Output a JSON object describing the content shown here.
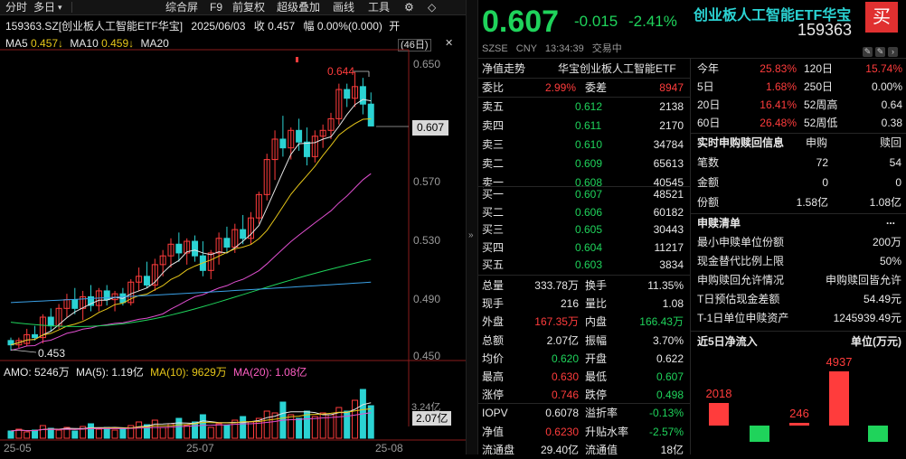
{
  "toolbar": {
    "items": [
      "分时",
      "多日",
      "▾",
      "综合屏",
      "F9",
      "前复权",
      "超级叠加",
      "画线",
      "工具",
      "⚙",
      "◇"
    ]
  },
  "chart_header": {
    "title": "159363.SZ[创业板人工智能ETF华宝]",
    "date": "2025/06/03",
    "close_label": "收 0.457",
    "change_label": "幅 0.00%(0.000)",
    "tail": "开"
  },
  "ma_line": {
    "ma5_label": "MA5",
    "ma5_value": "0.457↓",
    "ma10_label": "MA10",
    "ma10_value": "0.459↓",
    "ma20_label": "MA20",
    "days_badge": "(46日)"
  },
  "price_axis": {
    "ticks": [
      "0.650",
      "0.610",
      "0.570",
      "0.530",
      "0.490",
      "0.450"
    ],
    "current": "0.607",
    "high_label": "0.644",
    "low_label": "0.453"
  },
  "volume_header": {
    "amo": "AMO: 5246万",
    "ma5": "MA(5): 1.19亿",
    "ma10": "MA(10): 9629万",
    "ma20": "MA(20): 1.08亿"
  },
  "volume_axis": {
    "tick": "3.24亿",
    "current": "2.07亿"
  },
  "date_axis": [
    "25-05",
    "25-07",
    "25-08"
  ],
  "colors": {
    "up": "#ff3c3c",
    "down": "#1fd35b",
    "ma5": "#e6e6e6",
    "ma10": "#e6c619",
    "ma20": "#e04fd0",
    "ma60": "#1fd35b",
    "ma120": "#3aa0e6",
    "current": "#2bd3d3"
  },
  "quote": {
    "price": "0.607",
    "change": "-0.015",
    "pct": "-2.41%",
    "name": "创业板人工智能ETF华宝",
    "code": "159363",
    "buy_button": "买",
    "exchange": "SZSE",
    "currency": "CNY",
    "time": "13:34:39",
    "status": "交易中"
  },
  "order_book": {
    "header_left": "净值走势",
    "header_right": "华宝创业板人工智能ETF",
    "ratio_label": "委比",
    "ratio": "2.99%",
    "diff_label": "委差",
    "diff": "8947",
    "asks": [
      {
        "label": "卖五",
        "price": "0.612",
        "vol": "2138"
      },
      {
        "label": "卖四",
        "price": "0.611",
        "vol": "2170"
      },
      {
        "label": "卖三",
        "price": "0.610",
        "vol": "34784"
      },
      {
        "label": "卖二",
        "price": "0.609",
        "vol": "65613"
      },
      {
        "label": "卖一",
        "price": "0.608",
        "vol": "40545"
      }
    ],
    "bids": [
      {
        "label": "买一",
        "price": "0.607",
        "vol": "48521"
      },
      {
        "label": "买二",
        "price": "0.606",
        "vol": "60182"
      },
      {
        "label": "买三",
        "price": "0.605",
        "vol": "30443"
      },
      {
        "label": "买四",
        "price": "0.604",
        "vol": "11217"
      },
      {
        "label": "买五",
        "price": "0.603",
        "vol": "3834"
      }
    ]
  },
  "stats": [
    {
      "l1": "总量",
      "v1": "333.78万",
      "l2": "换手",
      "v2": "11.35%",
      "c1": "white",
      "c2": "white"
    },
    {
      "l1": "现手",
      "v1": "216",
      "l2": "量比",
      "v2": "1.08",
      "c1": "white",
      "c2": "white"
    },
    {
      "l1": "外盘",
      "v1": "167.35万",
      "l2": "内盘",
      "v2": "166.43万",
      "c1": "red",
      "c2": "green"
    },
    {
      "l1": "总额",
      "v1": "2.07亿",
      "l2": "振幅",
      "v2": "3.70%",
      "c1": "white",
      "c2": "white"
    },
    {
      "l1": "均价",
      "v1": "0.620",
      "l2": "开盘",
      "v2": "0.622",
      "c1": "green",
      "c2": "white"
    },
    {
      "l1": "最高",
      "v1": "0.630",
      "l2": "最低",
      "v2": "0.607",
      "c1": "red",
      "c2": "green"
    },
    {
      "l1": "涨停",
      "v1": "0.746",
      "l2": "跌停",
      "v2": "0.498",
      "c1": "red",
      "c2": "green"
    },
    {
      "l1": "IOPV",
      "v1": "0.6078",
      "l2": "溢折率",
      "v2": "-0.13%",
      "c1": "white",
      "c2": "green"
    },
    {
      "l1": "净值",
      "v1": "0.6230",
      "l2": "升贴水率",
      "v2": "-2.57%",
      "c1": "red",
      "c2": "green"
    },
    {
      "l1": "流通盘",
      "v1": "29.40亿",
      "l2": "流通值",
      "v2": "18亿",
      "c1": "white",
      "c2": "white"
    }
  ],
  "performance": [
    {
      "l1": "今年",
      "v1": "25.83%",
      "l2": "120日",
      "v2": "15.74%",
      "c1": "red",
      "c2": "red"
    },
    {
      "l1": "5日",
      "v1": "1.68%",
      "l2": "250日",
      "v2": "0.00%",
      "c1": "red",
      "c2": "white"
    },
    {
      "l1": "20日",
      "v1": "16.41%",
      "l2": "52周高",
      "v2": "0.64",
      "c1": "red",
      "c2": "white"
    },
    {
      "l1": "60日",
      "v1": "26.48%",
      "l2": "52周低",
      "v2": "0.38",
      "c1": "red",
      "c2": "white"
    }
  ],
  "subscribe": {
    "title": "实时申购赎回信息",
    "col1": "申购",
    "col2": "赎回",
    "rows": [
      {
        "label": "笔数",
        "v1": "72",
        "v2": "54"
      },
      {
        "label": "金额",
        "v1": "0",
        "v2": "0"
      },
      {
        "label": "份额",
        "v1": "1.58亿",
        "v2": "1.08亿"
      }
    ]
  },
  "list": {
    "title": "申赎清单",
    "more": "...",
    "rows": [
      {
        "label": "最小申赎单位份额",
        "value": "200万"
      },
      {
        "label": "现金替代比例上限",
        "value": "50%"
      },
      {
        "label": "申购赎回允许情况",
        "value": "申购赎回皆允许"
      },
      {
        "label": "T日预估现金差额",
        "value": "54.49元"
      },
      {
        "label": "T-1日单位申赎资产",
        "value": "1245939.49元"
      }
    ]
  },
  "netflow": {
    "title": "近5日净流入",
    "unit": "单位(万元)",
    "chart_data": {
      "type": "bar",
      "categories": [
        "1",
        "2",
        "3",
        "4",
        "5"
      ],
      "values": [
        2018,
        -1500,
        246,
        4937,
        -1500
      ],
      "labels": [
        "2018",
        "",
        "246",
        "4937",
        ""
      ]
    }
  }
}
